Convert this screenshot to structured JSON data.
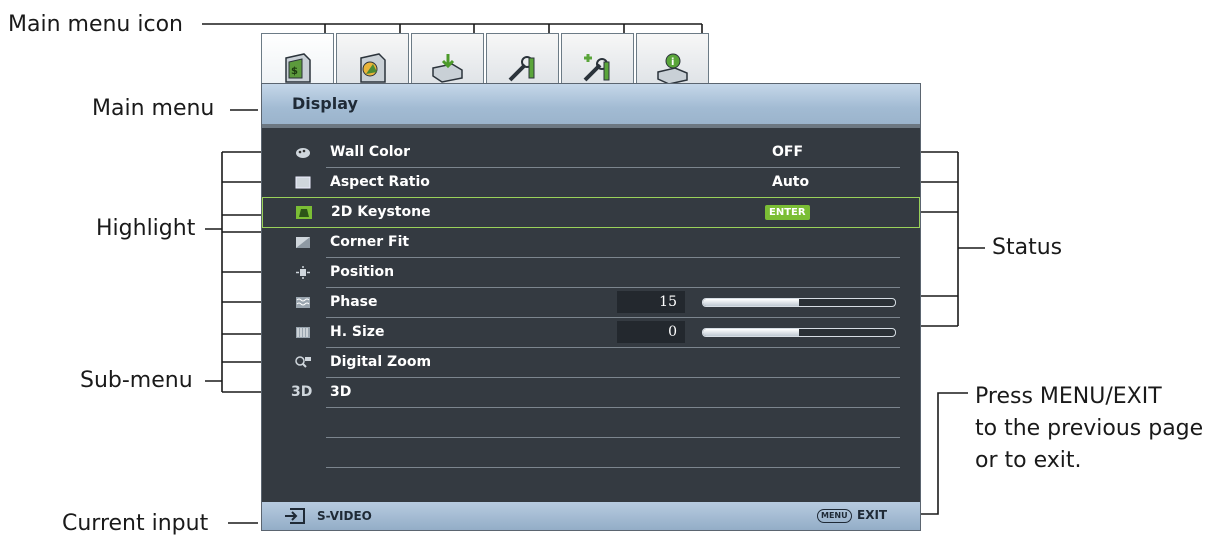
{
  "callouts": {
    "main_menu_icon": "Main menu icon",
    "main_menu": "Main menu",
    "highlight": "Highlight",
    "sub_menu": "Sub-menu",
    "current_input": "Current input",
    "status": "Status",
    "press_line1": "Press MENU/EXIT",
    "press_line2": "to the previous page",
    "press_line3": "or to exit."
  },
  "tabs": [
    {
      "icon": "display-menu-icon",
      "active": true
    },
    {
      "icon": "picture-menu-icon",
      "active": false
    },
    {
      "icon": "source-menu-icon",
      "active": false
    },
    {
      "icon": "system-setup-basic-icon",
      "active": false
    },
    {
      "icon": "system-setup-advanced-icon",
      "active": false
    },
    {
      "icon": "information-menu-icon",
      "active": false
    }
  ],
  "osd": {
    "title": "Display",
    "items": [
      {
        "icon": "palette-icon",
        "label": "Wall Color",
        "status": "OFF"
      },
      {
        "icon": "aspect-ratio-icon",
        "label": "Aspect Ratio",
        "status": "Auto"
      },
      {
        "icon": "keystone-icon",
        "label": "2D Keystone",
        "status": "ENTER",
        "highlighted": true
      },
      {
        "icon": "corner-fit-icon",
        "label": "Corner Fit",
        "status": ""
      },
      {
        "icon": "position-icon",
        "label": "Position",
        "status": ""
      },
      {
        "icon": "phase-icon",
        "label": "Phase",
        "value": "15",
        "level": 0.5
      },
      {
        "icon": "hsize-icon",
        "label": "H. Size",
        "value": "0",
        "level": 0.5
      },
      {
        "icon": "digital-zoom-icon",
        "label": "Digital Zoom",
        "status": ""
      },
      {
        "icon": "3d-icon",
        "label": "3D",
        "status": ""
      }
    ],
    "footer": {
      "source": "S-VIDEO",
      "menu_key": "MENU",
      "exit": "EXIT"
    }
  }
}
